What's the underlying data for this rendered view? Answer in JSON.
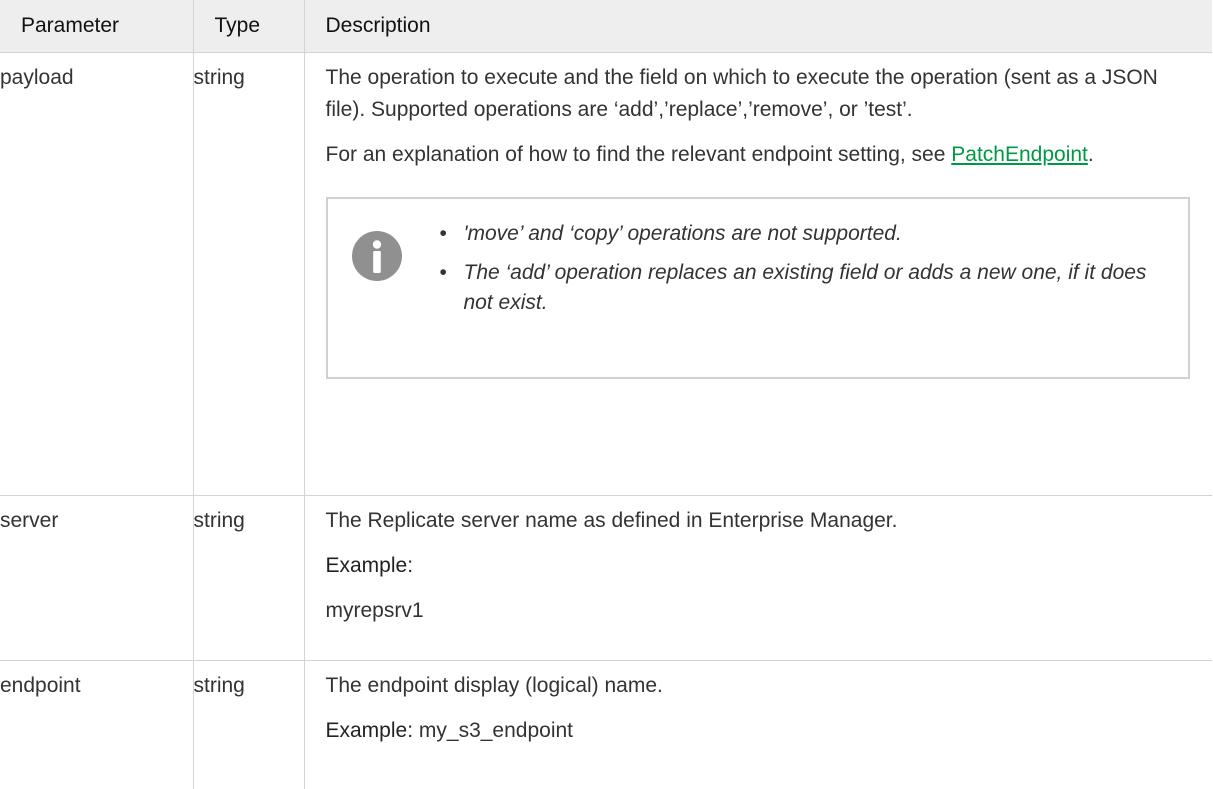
{
  "table": {
    "headers": [
      "Parameter",
      "Type",
      "Description"
    ],
    "rows": {
      "payload": {
        "parameter": "payload",
        "type": "string",
        "description": "The operation to execute and the field on which to execute the operation (sent as a JSON file). Supported operations are ‘add’,’replace’,’remove’, or ’test’.",
        "explanation_text": "For an explanation of how to find the relevant endpoint setting, see",
        "link_text": "PatchEndpoint",
        "link_suffix": ".",
        "note_icon": "info-icon",
        "notes": [
          "'move’ and ‘copy’ operations are not supported.",
          "The ‘add’ operation replaces an existing field or adds a new one, if it does not exist."
        ]
      },
      "server": {
        "parameter": "server",
        "type": "string",
        "description": "The Replicate server name as defined in Enterprise Manager.",
        "example_label": "Example:",
        "example_value": "myrepsrv1"
      },
      "endpoint": {
        "parameter": "endpoint",
        "type": "string",
        "description": "The endpoint display (logical) name.",
        "example_label": "Example:",
        "example_value": "my_s3_endpoint"
      }
    }
  },
  "colors": {
    "link": "#009845",
    "header_bg": "#eeeeee",
    "border": "#d4d4d4",
    "icon": "#909090"
  }
}
